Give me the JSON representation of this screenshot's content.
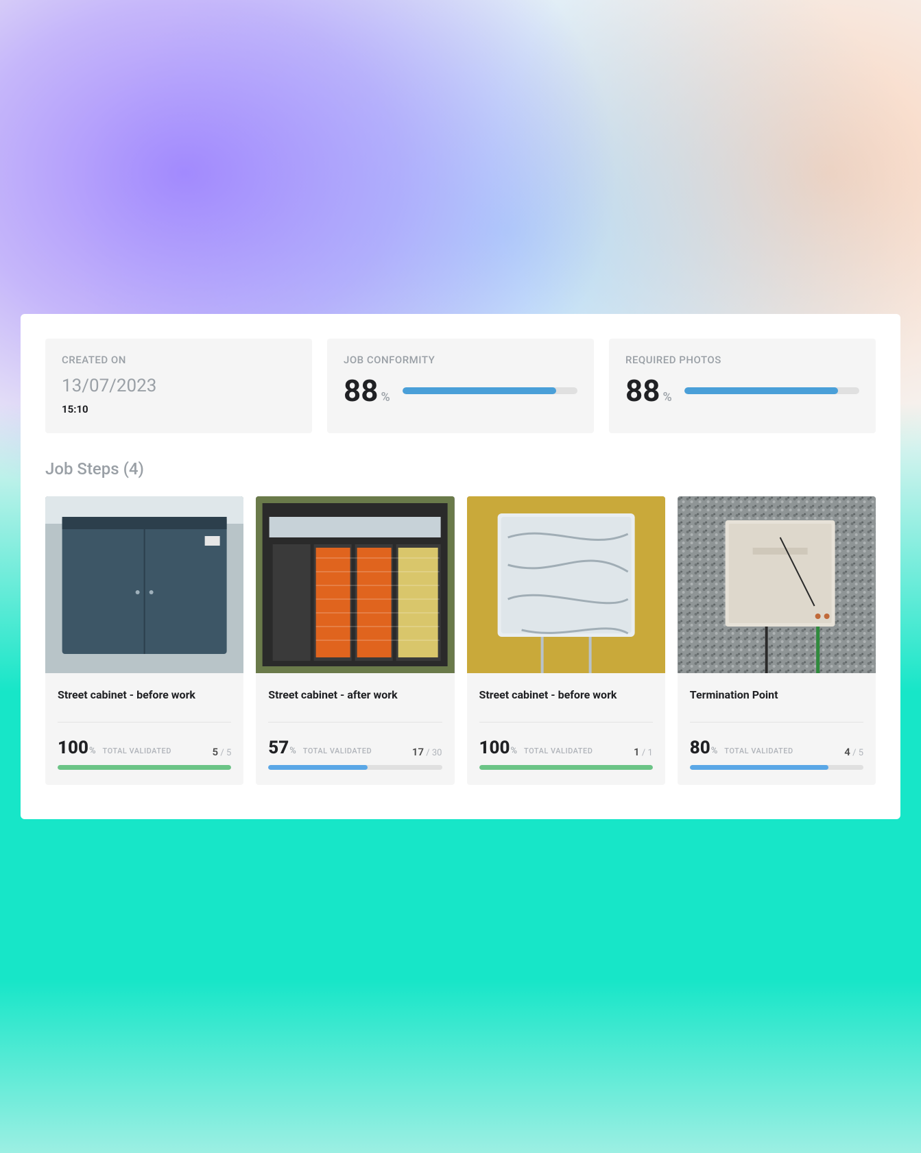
{
  "metrics": {
    "created": {
      "label": "CREATED  ON",
      "date": "13/07/2023",
      "time": "15:10"
    },
    "conformity": {
      "label": "JOB CONFORMITY",
      "value": "88",
      "percent": 88
    },
    "photos": {
      "label": "REQUIRED PHOTOS",
      "value": "88",
      "percent": 88
    }
  },
  "section": {
    "heading": "Job Steps (4)"
  },
  "labels": {
    "pct_symbol": "%",
    "total_validated": "TOTAL VALIDATED"
  },
  "steps": [
    {
      "title": "Street cabinet - before work",
      "percent": 100,
      "percent_text": "100",
      "done": "5",
      "total": "5",
      "bar_color": "green"
    },
    {
      "title": "Street cabinet - after work",
      "percent": 57,
      "percent_text": "57",
      "done": "17",
      "total": "30",
      "bar_color": "blue"
    },
    {
      "title": "Street cabinet - before work",
      "percent": 100,
      "percent_text": "100",
      "done": "1",
      "total": "1",
      "bar_color": "green"
    },
    {
      "title": "Termination Point",
      "percent": 80,
      "percent_text": "80",
      "done": "4",
      "total": "5",
      "bar_color": "blue"
    }
  ]
}
